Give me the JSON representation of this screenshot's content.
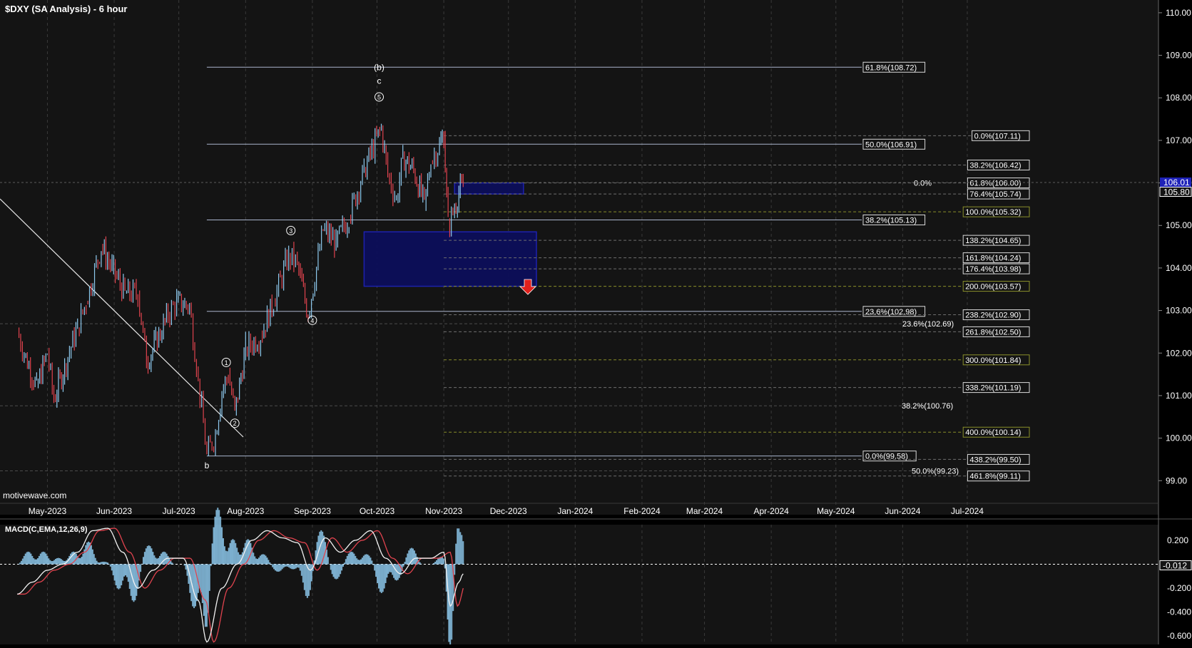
{
  "title": "$DXY (SA Analysis) - 6 hour",
  "watermark": "motivewave.com",
  "colors": {
    "background": "#141414",
    "grid": "#3a3a3a",
    "text": "#ffffff",
    "fib_line": "#a9b4cc",
    "ext_line": "#8a8f2a",
    "box": "#1e22b8",
    "box_fill": "#0c0e5a",
    "candle_up": "#8ec9ee",
    "candle_down": "#e0434e",
    "macd_line": "#f2f2f2",
    "signal_line": "#e0434e",
    "hist": "#8ec9ee",
    "arrow": "#e0201c"
  },
  "chart_data": [
    {
      "type": "line",
      "title": "$DXY (SA Analysis) - 6 hour",
      "x_axis_labels": [
        "May-2023",
        "Jun-2023",
        "Jul-2023",
        "Aug-2023",
        "Sep-2023",
        "Oct-2023",
        "Nov-2023",
        "Dec-2023",
        "Jan-2024",
        "Feb-2024",
        "Mar-2024",
        "Apr-2024",
        "May-2024",
        "Jun-2024",
        "Jul-2024"
      ],
      "y_ticks": [
        "110.00",
        "109.00",
        "108.00",
        "107.00",
        "106.00",
        "105.00",
        "104.00",
        "103.00",
        "102.00",
        "101.00",
        "100.00",
        "99.00"
      ],
      "ylim": [
        98.2,
        110.3
      ],
      "price_path": [
        [
          "2023-04-17",
          102.5
        ],
        [
          "2023-04-21",
          101.9
        ],
        [
          "2023-04-26",
          101.2
        ],
        [
          "2023-05-01",
          102.0
        ],
        [
          "2023-05-04",
          100.9
        ],
        [
          "2023-05-09",
          101.7
        ],
        [
          "2023-05-15",
          102.6
        ],
        [
          "2023-05-19",
          103.2
        ],
        [
          "2023-05-26",
          104.5
        ],
        [
          "2023-05-31",
          104.0
        ],
        [
          "2023-06-06",
          103.4
        ],
        [
          "2023-06-12",
          103.4
        ],
        [
          "2023-06-16",
          101.8
        ],
        [
          "2023-06-21",
          102.3
        ],
        [
          "2023-06-26",
          102.9
        ],
        [
          "2023-06-30",
          103.2
        ],
        [
          "2023-07-06",
          103.1
        ],
        [
          "2023-07-10",
          101.4
        ],
        [
          "2023-07-14",
          99.6
        ],
        [
          "2023-07-18",
          100.1
        ],
        [
          "2023-07-21",
          101.1
        ],
        [
          "2023-07-24",
          101.5
        ],
        [
          "2023-07-27",
          100.6
        ],
        [
          "2023-08-01",
          102.1
        ],
        [
          "2023-08-08",
          102.4
        ],
        [
          "2023-08-14",
          103.2
        ],
        [
          "2023-08-21",
          104.3
        ],
        [
          "2023-08-25",
          104.1
        ],
        [
          "2023-08-30",
          102.9
        ],
        [
          "2023-09-06",
          104.9
        ],
        [
          "2023-09-12",
          104.6
        ],
        [
          "2023-09-18",
          105.2
        ],
        [
          "2023-09-25",
          106.3
        ],
        [
          "2023-10-03",
          107.3
        ],
        [
          "2023-10-06",
          106.2
        ],
        [
          "2023-10-10",
          105.6
        ],
        [
          "2023-10-13",
          106.6
        ],
        [
          "2023-10-18",
          106.3
        ],
        [
          "2023-10-23",
          105.5
        ],
        [
          "2023-10-26",
          106.5
        ],
        [
          "2023-10-30",
          106.9
        ],
        [
          "2023-11-01",
          107.1
        ],
        [
          "2023-11-03",
          105.0
        ],
        [
          "2023-11-06",
          105.4
        ],
        [
          "2023-11-08",
          105.8
        ],
        [
          "2023-11-10",
          105.9
        ]
      ],
      "current_price": "105.80",
      "current_price_box": "106.01",
      "fib_levels": [
        {
          "label": "61.8%(108.72)",
          "value": 108.72
        },
        {
          "label": "50.0%(106.91)",
          "value": 106.91
        },
        {
          "label": "38.2%(105.13)",
          "value": 105.13
        },
        {
          "label": "23.6%(102.98)",
          "value": 102.98
        },
        {
          "label": "0.0%(99.58)",
          "value": 99.58
        }
      ],
      "ext_levels": [
        {
          "label": "0.0%(107.11)",
          "value": 107.11
        },
        {
          "label": "38.2%(106.42)",
          "value": 106.42
        },
        {
          "label": "61.8%(106.00)",
          "value": 106.0
        },
        {
          "label": "76.4%(105.74)",
          "value": 105.74
        },
        {
          "label": "100.0%(105.32)",
          "value": 105.32
        },
        {
          "label": "138.2%(104.65)",
          "value": 104.65
        },
        {
          "label": "161.8%(104.24)",
          "value": 104.24
        },
        {
          "label": "176.4%(103.98)",
          "value": 103.98
        },
        {
          "label": "200.0%(103.57)",
          "value": 103.57
        },
        {
          "label": "238.2%(102.90)",
          "value": 102.9
        },
        {
          "label": "261.8%(102.50)",
          "value": 102.5
        },
        {
          "label": "300.0%(101.84)",
          "value": 101.84
        },
        {
          "label": "338.2%(101.19)",
          "value": 101.19
        },
        {
          "label": "400.0%(100.14)",
          "value": 100.14
        },
        {
          "label": "438.2%(99.50)",
          "value": 99.5
        },
        {
          "label": "461.8%(99.11)",
          "value": 99.11
        }
      ],
      "other_levels": [
        {
          "label": "0.0%",
          "value": 106.0
        },
        {
          "label": "23.6%(102.69)",
          "value": 102.69
        },
        {
          "label": "38.2%(100.76)",
          "value": 100.76
        },
        {
          "label": "50.0%(99.23)",
          "value": 99.23
        }
      ],
      "zones": [
        {
          "name": "target zone small",
          "start": "2023-11-06",
          "end": "2023-12-08",
          "low": 105.74,
          "high": 106.0
        },
        {
          "name": "target zone large",
          "start": "2023-09-25",
          "end": "2023-12-14",
          "low": 103.57,
          "high": 104.85
        }
      ],
      "wave_labels": [
        {
          "text": "(b)",
          "date": "2023-10-02",
          "value": 108.72
        },
        {
          "text": "c",
          "date": "2023-10-02",
          "value": 108.4
        },
        {
          "text": "5",
          "date": "2023-10-02",
          "value": 108.02,
          "circled": true
        },
        {
          "text": "1",
          "date": "2023-07-23",
          "value": 101.78,
          "circled": true
        },
        {
          "text": "2",
          "date": "2023-07-27",
          "value": 100.35,
          "circled": true
        },
        {
          "text": "3",
          "date": "2023-08-22",
          "value": 104.88,
          "circled": true
        },
        {
          "text": "4",
          "date": "2023-09-01",
          "value": 102.77,
          "circled": true
        },
        {
          "text": "b",
          "date": "2023-07-14",
          "value": 99.36
        }
      ]
    },
    {
      "type": "line",
      "title": "MACD(C,EMA,12,26,9)",
      "y_ticks": [
        "0.200",
        "-0.200",
        "-0.400",
        "-0.600"
      ],
      "ylim": [
        -0.67,
        0.33
      ],
      "current_value": "-0.012",
      "macd": [
        [
          "2023-04-17",
          -0.25
        ],
        [
          "2023-04-24",
          -0.15
        ],
        [
          "2023-05-01",
          -0.05
        ],
        [
          "2023-05-08",
          0.0
        ],
        [
          "2023-05-15",
          0.1
        ],
        [
          "2023-05-22",
          0.28
        ],
        [
          "2023-05-29",
          0.3
        ],
        [
          "2023-06-05",
          0.1
        ],
        [
          "2023-06-12",
          -0.2
        ],
        [
          "2023-06-19",
          -0.05
        ],
        [
          "2023-06-26",
          0.05
        ],
        [
          "2023-07-03",
          0.05
        ],
        [
          "2023-07-10",
          -0.3
        ],
        [
          "2023-07-14",
          -0.65
        ],
        [
          "2023-07-21",
          -0.2
        ],
        [
          "2023-07-28",
          0.0
        ],
        [
          "2023-08-04",
          0.2
        ],
        [
          "2023-08-11",
          0.28
        ],
        [
          "2023-08-18",
          0.22
        ],
        [
          "2023-08-25",
          0.18
        ],
        [
          "2023-08-31",
          -0.05
        ],
        [
          "2023-09-07",
          0.22
        ],
        [
          "2023-09-14",
          0.1
        ],
        [
          "2023-09-21",
          0.2
        ],
        [
          "2023-09-28",
          0.28
        ],
        [
          "2023-10-05",
          0.05
        ],
        [
          "2023-10-12",
          -0.08
        ],
        [
          "2023-10-19",
          0.05
        ],
        [
          "2023-10-26",
          0.05
        ],
        [
          "2023-11-01",
          0.1
        ],
        [
          "2023-11-04",
          -0.35
        ],
        [
          "2023-11-08",
          -0.15
        ],
        [
          "2023-11-10",
          -0.08
        ]
      ],
      "signal_lag_days": 3
    }
  ]
}
